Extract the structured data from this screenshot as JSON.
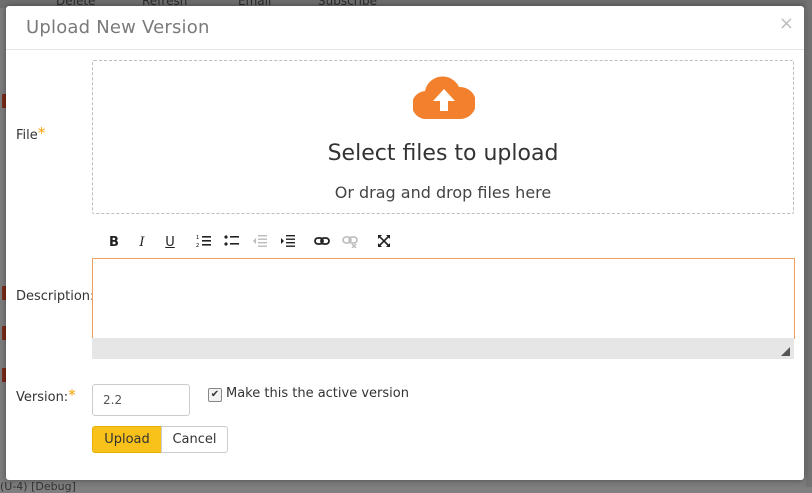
{
  "background": {
    "toolbar_items": [
      "Delete",
      "Refresh",
      "Email",
      "Subscribe"
    ],
    "bottom_text": "(U-4) [Debug]"
  },
  "modal": {
    "title": "Upload New Version",
    "close_glyph": "×"
  },
  "file": {
    "label": "File",
    "required_mark": "*",
    "dropzone_title": "Select files to upload",
    "dropzone_subtitle": "Or drag and drop files here",
    "cloud_color": "#f2802c"
  },
  "description": {
    "label": "Description:",
    "toolbar": {
      "bold": "B",
      "italic": "I",
      "underline": "U"
    }
  },
  "version": {
    "label": "Version:",
    "required_mark": "*",
    "value": "2.2",
    "active_label": "Make this the active version",
    "active_checked": true
  },
  "buttons": {
    "upload": "Upload",
    "cancel": "Cancel"
  },
  "colors": {
    "accent": "#f9c21b",
    "required": "#f4a000",
    "editor_focus": "#f0a060"
  }
}
